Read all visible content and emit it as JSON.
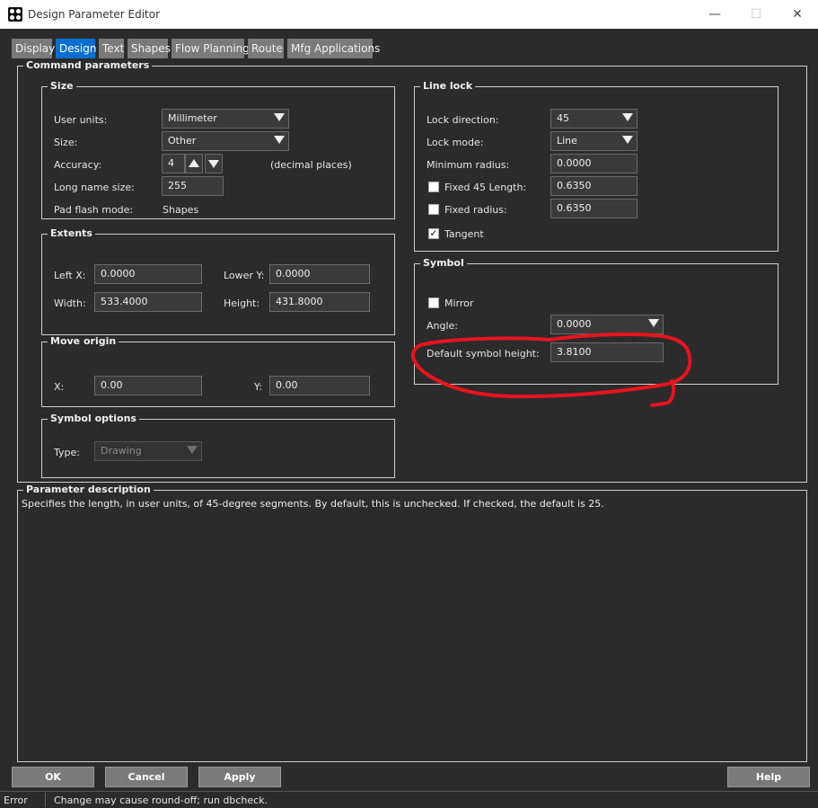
{
  "window": {
    "title": "Design Parameter Editor",
    "controls": {
      "minimize": "—",
      "maximize": "☐",
      "close": "✕"
    }
  },
  "tabs": [
    {
      "label": "Display"
    },
    {
      "label": "Design",
      "active": true
    },
    {
      "label": "Text"
    },
    {
      "label": "Shapes"
    },
    {
      "label": "Flow Planning"
    },
    {
      "label": "Route"
    },
    {
      "label": "Mfg Applications"
    }
  ],
  "command_parameters": {
    "title": "Command parameters",
    "size": {
      "title": "Size",
      "user_units_label": "User units:",
      "user_units_value": "Millimeter",
      "size_label": "Size:",
      "size_value": "Other",
      "accuracy_label": "Accuracy:",
      "accuracy_value": "4",
      "accuracy_suffix": "(decimal places)",
      "long_name_label": "Long name size:",
      "long_name_value": "255",
      "pad_flash_label": "Pad flash mode:",
      "pad_flash_value": "Shapes"
    },
    "extents": {
      "title": "Extents",
      "left_x_label": "Left X:",
      "left_x_value": "0.0000",
      "lower_y_label": "Lower Y:",
      "lower_y_value": "0.0000",
      "width_label": "Width:",
      "width_value": "533.4000",
      "height_label": "Height:",
      "height_value": "431.8000"
    },
    "move_origin": {
      "title": "Move origin",
      "x_label": "X:",
      "x_value": "0.00",
      "y_label": "Y:",
      "y_value": "0.00"
    },
    "symbol_options": {
      "title": "Symbol options",
      "type_label": "Type:",
      "type_value": "Drawing"
    },
    "line_lock": {
      "title": "Line lock",
      "lock_direction_label": "Lock direction:",
      "lock_direction_value": "45",
      "lock_mode_label": "Lock mode:",
      "lock_mode_value": "Line",
      "min_radius_label": "Minimum radius:",
      "min_radius_value": "0.0000",
      "fixed45_label": "Fixed 45 Length:",
      "fixed45_value": "0.6350",
      "fixed45_checked": false,
      "fixed_radius_label": "Fixed radius:",
      "fixed_radius_value": "0.6350",
      "fixed_radius_checked": false,
      "tangent_label": "Tangent",
      "tangent_checked": true,
      "check_mark": "✓"
    },
    "symbol": {
      "title": "Symbol",
      "mirror_label": "Mirror",
      "mirror_checked": false,
      "angle_label": "Angle:",
      "angle_value": "0.0000",
      "default_height_label": "Default symbol height:",
      "default_height_value": "3.8100"
    }
  },
  "parameter_description": {
    "title": "Parameter description",
    "text": "Specifies the length, in user units, of 45-degree segments. By default, this is unchecked. If checked, the default is 25."
  },
  "buttons": {
    "ok": "OK",
    "cancel": "Cancel",
    "apply": "Apply",
    "help": "Help"
  },
  "status": {
    "level": "Error",
    "message": "Change may cause round-off; run dbcheck."
  },
  "colors": {
    "background": "#2b2b2b",
    "tab_active": "#0a6fd1",
    "tab": "#7a7a7a",
    "annotation": "#e8141e"
  }
}
